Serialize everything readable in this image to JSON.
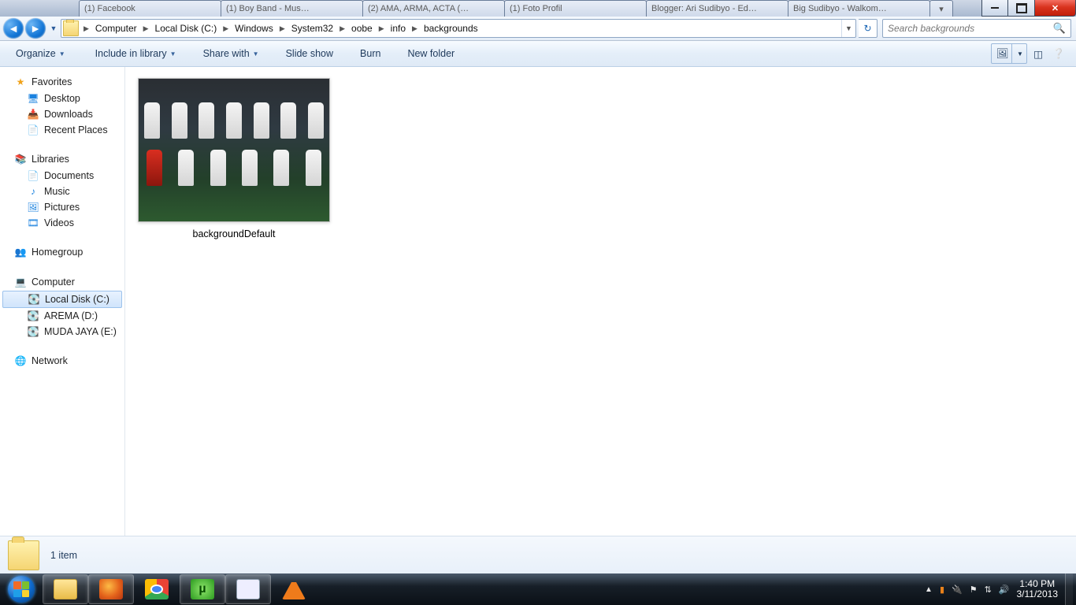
{
  "browser_tabs": [
    "(1) Facebook",
    "(1) Boy Band - Mus…",
    "(2) AMA, ARMA, ACTA (…",
    "(1) Foto Profil",
    "Blogger: Ari Sudibyo - Ed…",
    "Big Sudibyo - Walkom…"
  ],
  "breadcrumbs": [
    "Computer",
    "Local Disk (C:)",
    "Windows",
    "System32",
    "oobe",
    "info",
    "backgrounds"
  ],
  "search": {
    "placeholder": "Search backgrounds"
  },
  "toolbar": {
    "organize": "Organize",
    "include": "Include in library",
    "share": "Share with",
    "slideshow": "Slide show",
    "burn": "Burn",
    "newfolder": "New folder"
  },
  "sidebar": {
    "favorites": "Favorites",
    "desktop": "Desktop",
    "downloads": "Downloads",
    "recent": "Recent Places",
    "libraries": "Libraries",
    "documents": "Documents",
    "music": "Music",
    "pictures": "Pictures",
    "videos": "Videos",
    "homegroup": "Homegroup",
    "computer": "Computer",
    "drive_c": "Local Disk (C:)",
    "drive_d": "AREMA (D:)",
    "drive_e": "MUDA JAYA (E:)",
    "network": "Network"
  },
  "file": {
    "name": "backgroundDefault"
  },
  "details": {
    "count": "1 item"
  },
  "tray": {
    "time": "1:40 PM",
    "date": "3/11/2013"
  }
}
